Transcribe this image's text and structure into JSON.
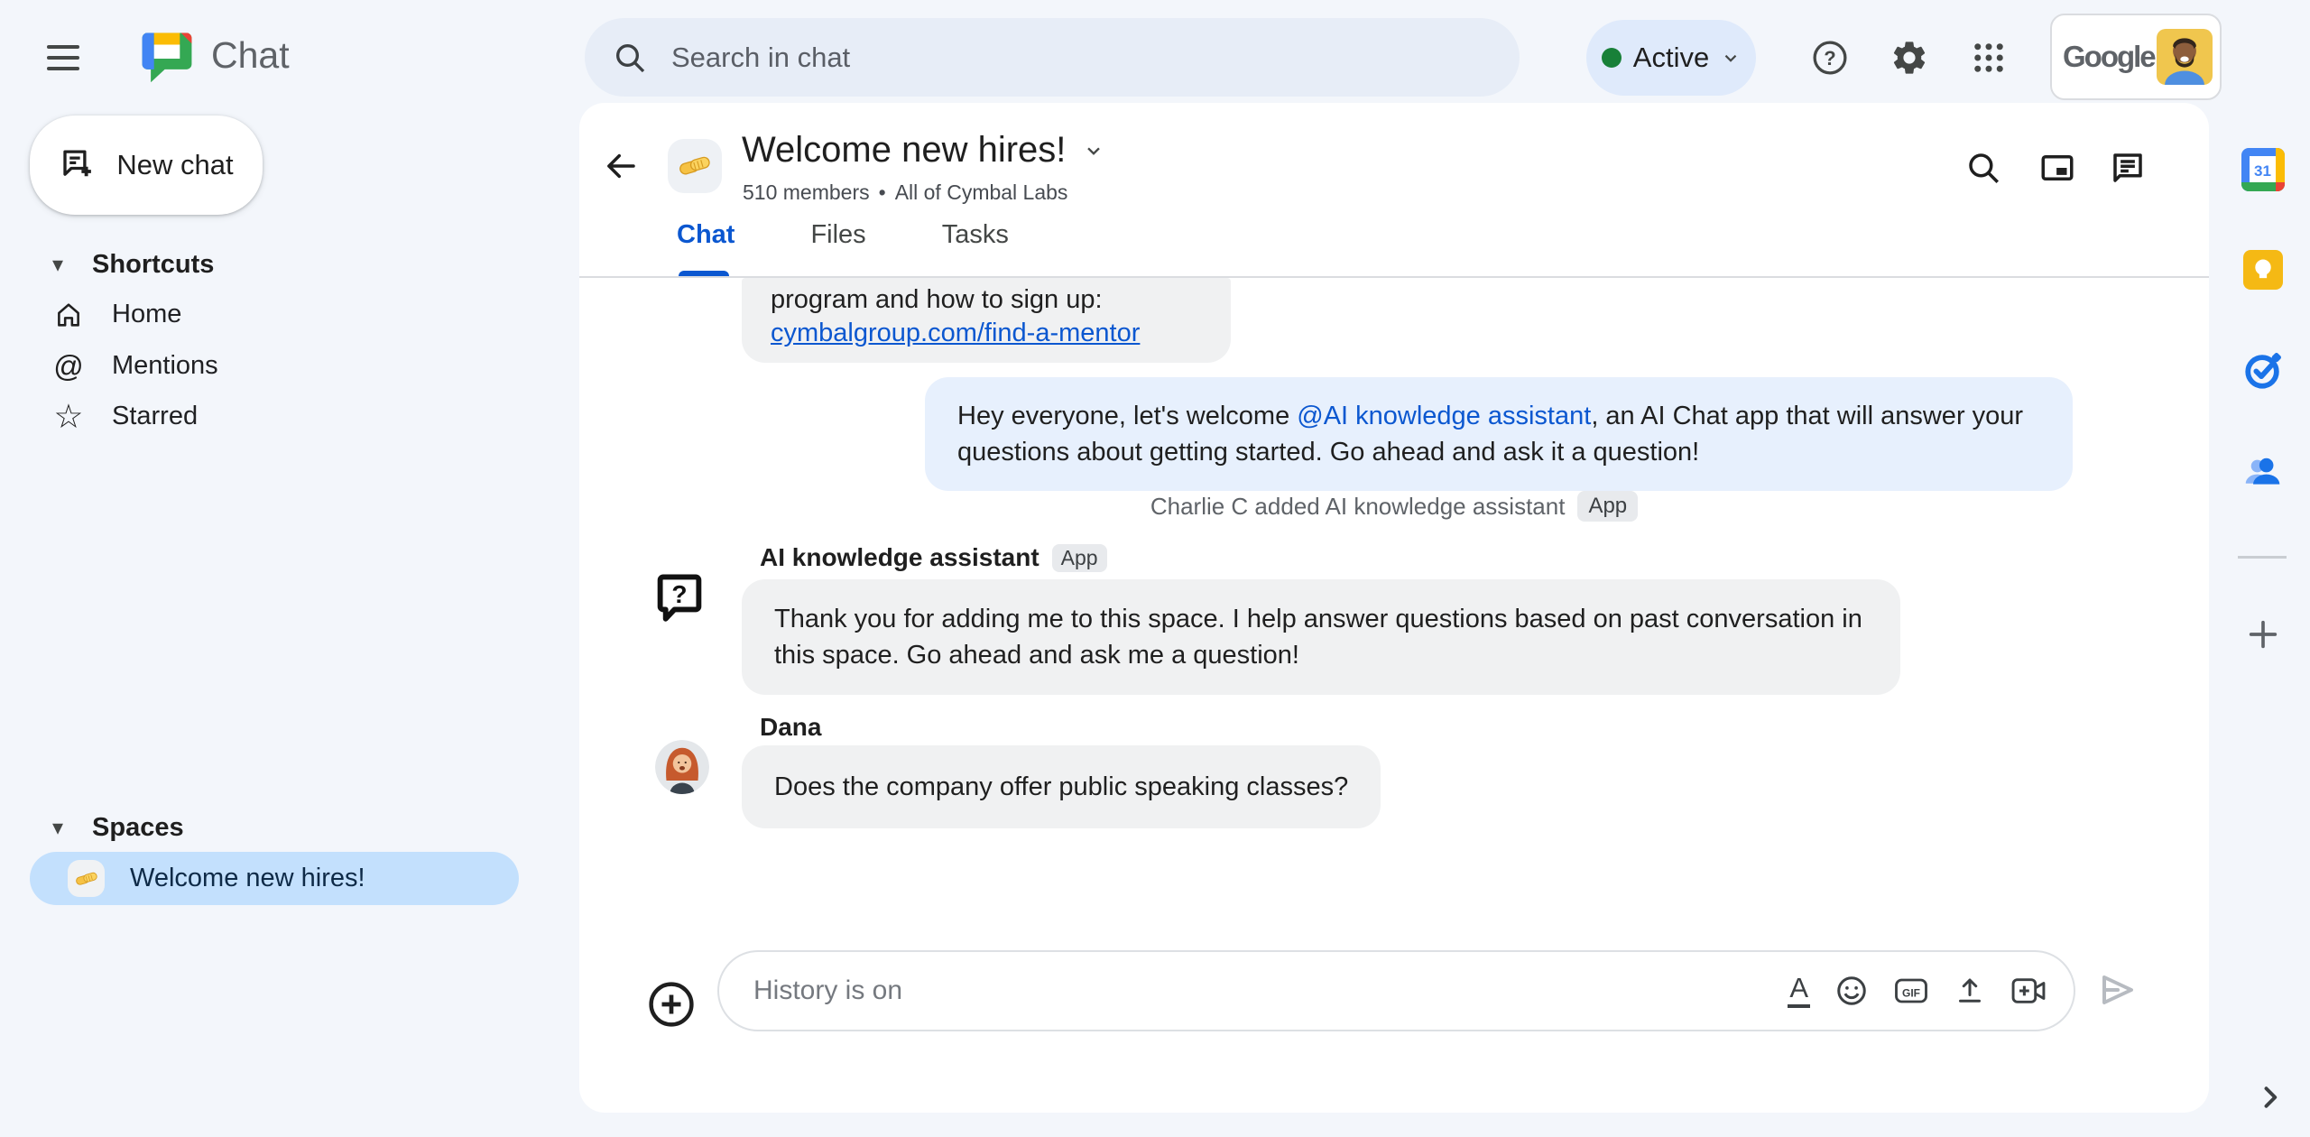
{
  "topbar": {
    "app_name": "Chat",
    "search_placeholder": "Search in chat",
    "status_label": "Active",
    "google_wordmark": "Google"
  },
  "sidebar": {
    "new_chat": "New chat",
    "shortcuts_label": "Shortcuts",
    "items": [
      {
        "label": "Home"
      },
      {
        "label": "Mentions"
      },
      {
        "label": "Starred"
      }
    ],
    "spaces_label": "Spaces",
    "space": {
      "label": "Welcome new hires!"
    }
  },
  "header": {
    "title": "Welcome new hires!",
    "members": "510 members",
    "separator": "•",
    "org": "All of Cymbal Labs",
    "tabs": [
      {
        "label": "Chat"
      },
      {
        "label": "Files"
      },
      {
        "label": "Tasks"
      }
    ]
  },
  "messages": {
    "partial": {
      "text": "program and how to sign up:",
      "link": "cymbalgroup.com/find-a-mentor"
    },
    "announcement": {
      "pre": "Hey everyone, let's welcome ",
      "mention": "@AI knowledge assistant",
      "post": ", an AI Chat app that will answer your questions about getting started.  Go ahead and ask it a question!"
    },
    "system": {
      "text": "Charlie C added AI knowledge assistant",
      "badge": "App"
    },
    "assistant": {
      "sender": "AI knowledge assistant",
      "badge": "App",
      "text": "Thank you for adding me to this space. I help answer questions based on past conversation in this space. Go ahead and ask me a question!"
    },
    "user": {
      "sender": "Dana",
      "text": "Does the company offer public speaking classes?"
    }
  },
  "composer": {
    "placeholder": "History is on",
    "format_label": "A",
    "gif_label": "GIF"
  },
  "rail": {
    "calendar_label": "31"
  },
  "icons": {
    "at": "@",
    "star": "☆",
    "caret": "▾",
    "question": "?"
  },
  "colors": {
    "accent_blue": "#0b57d0",
    "mention_blue": "#0b57d0",
    "status_green": "#188038",
    "selected_space_bg": "#c3e0fd",
    "bubble_gray": "#f0f1f2",
    "bubble_highlight": "#e7f0fd",
    "page_bg": "#f3f6fb",
    "search_bg": "#e7edf7"
  }
}
